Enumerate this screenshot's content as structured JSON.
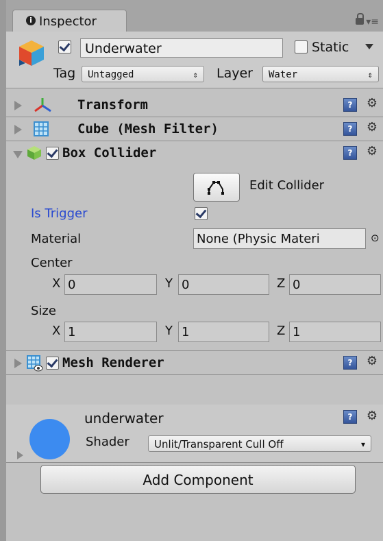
{
  "tab": {
    "label": "Inspector"
  },
  "object": {
    "name": "Underwater",
    "active": true,
    "static_label": "Static",
    "static": false
  },
  "tag": {
    "label": "Tag",
    "value": "Untagged"
  },
  "layer": {
    "label": "Layer",
    "value": "Water"
  },
  "components": {
    "transform": {
      "title": "Transform"
    },
    "mesh_filter": {
      "title": "Cube (Mesh Filter)"
    },
    "box_collider": {
      "title": "Box Collider",
      "enabled": true,
      "edit_label": "Edit Collider",
      "is_trigger_label": "Is Trigger",
      "is_trigger": true,
      "material_label": "Material",
      "material_value": "None (Physic Materi",
      "center_label": "Center",
      "center": {
        "x": "0",
        "y": "0",
        "z": "0"
      },
      "size_label": "Size",
      "size": {
        "x": "1",
        "y": "1",
        "z": "1"
      }
    },
    "mesh_renderer": {
      "title": "Mesh Renderer",
      "enabled": true
    }
  },
  "material": {
    "name": "underwater",
    "shader_label": "Shader",
    "shader_value": "Unlit/Transparent Cull Off"
  },
  "axes": {
    "x": "X",
    "y": "Y",
    "z": "Z"
  },
  "add_component": "Add Component",
  "colors": {
    "panel": "#c2c2c2",
    "trigger_label": "#2a4ad0",
    "material_ball": "#3c8bf0"
  }
}
